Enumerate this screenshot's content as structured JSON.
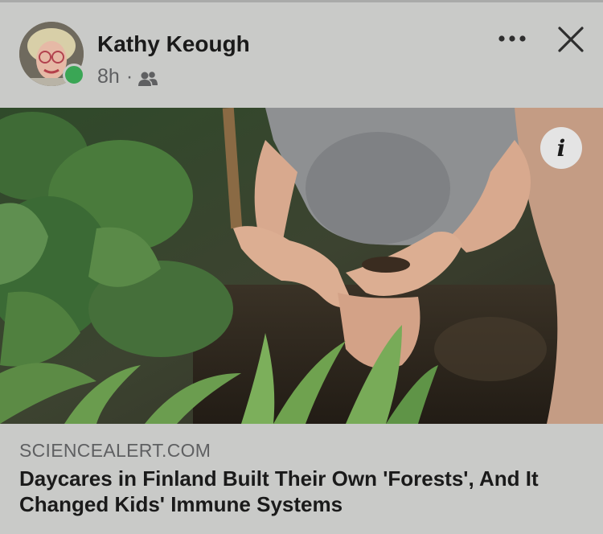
{
  "post": {
    "author_name": "Kathy Keough",
    "timestamp": "8h",
    "separator": "·",
    "audience_icon": "friends-icon",
    "online": true,
    "online_color": "#3aa655"
  },
  "actions": {
    "more_icon": "more-horizontal-icon",
    "close_icon": "close-icon",
    "info_icon": "info-icon",
    "info_glyph": "i"
  },
  "link_preview": {
    "domain": "SCIENCEALERT.COM",
    "headline": "Daycares in Finland Built Their Own 'Forests', And It Changed Kids' Immune Systems"
  },
  "image": {
    "subject": "child hands holding soil in garden"
  }
}
